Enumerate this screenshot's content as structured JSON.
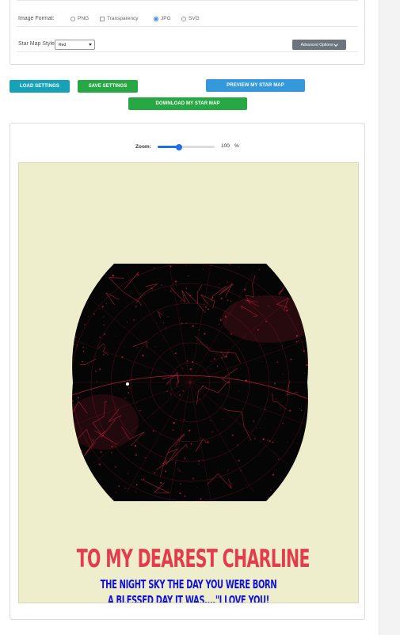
{
  "settings": {
    "image_format": {
      "label": "Image Format:",
      "options": [
        {
          "label": "PNG",
          "type": "radio",
          "selected": false
        },
        {
          "label": "Transparency",
          "type": "checkbox",
          "checked": false
        },
        {
          "label": "JPG",
          "type": "radio",
          "selected": true
        },
        {
          "label": "SVG",
          "type": "radio",
          "selected": false
        }
      ]
    },
    "star_map_style": {
      "label": "Star Map Style:",
      "selected": "Red"
    },
    "advanced_options_label": "Advanced Options"
  },
  "actions": {
    "load": "LOAD SETTINGS",
    "save": "SAVE SETTINGS",
    "preview": "PREVIEW MY STAR MAP",
    "download": "DOWNLOAD MY STAR MAP"
  },
  "zoom": {
    "label": "Zoom:",
    "value": "100",
    "unit": "%",
    "slider_fraction": 0.38
  },
  "poster": {
    "title": "TO MY DEAREST CHARLINE",
    "subtitle_line1": "THE NIGHT SKY THE DAY YOU WERE BORN",
    "subtitle_line2": "A BLESSED DAY IT WAS....\"I LOVE YOU!",
    "colors": {
      "background": "#eeeecc",
      "title": "#e23c4e",
      "subtitle": "#1111dd",
      "map_background": "#000000",
      "map_lines": "#c0203a"
    }
  },
  "colors": {
    "load_button": "#17a2b8",
    "save_button": "#28a745",
    "preview_button": "#3498db",
    "download_button": "#28a745",
    "advanced_button": "#6c757d",
    "accent": "#1e6ee8"
  }
}
